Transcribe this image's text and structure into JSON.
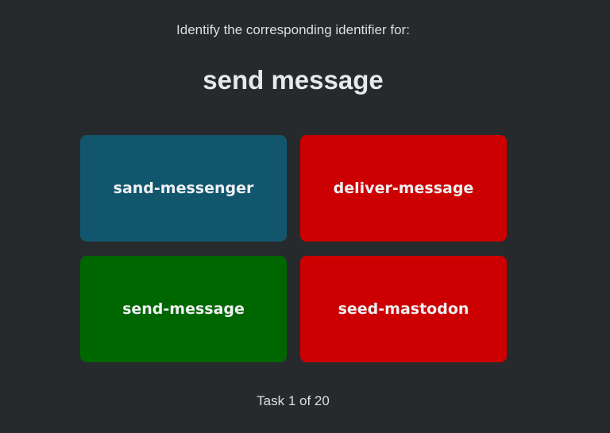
{
  "prompt": "Identify the corresponding identifier for:",
  "target": "send message",
  "choices": [
    {
      "label": "sand-messenger",
      "state": "neutral",
      "color": "#12566e"
    },
    {
      "label": "deliver-message",
      "state": "wrong",
      "color": "#cc0000"
    },
    {
      "label": "send-message",
      "state": "correct",
      "color": "#006600"
    },
    {
      "label": "seed-mastodon",
      "state": "wrong",
      "color": "#cc0000"
    }
  ],
  "progress": "Task 1 of 20",
  "background": "#272a2c"
}
